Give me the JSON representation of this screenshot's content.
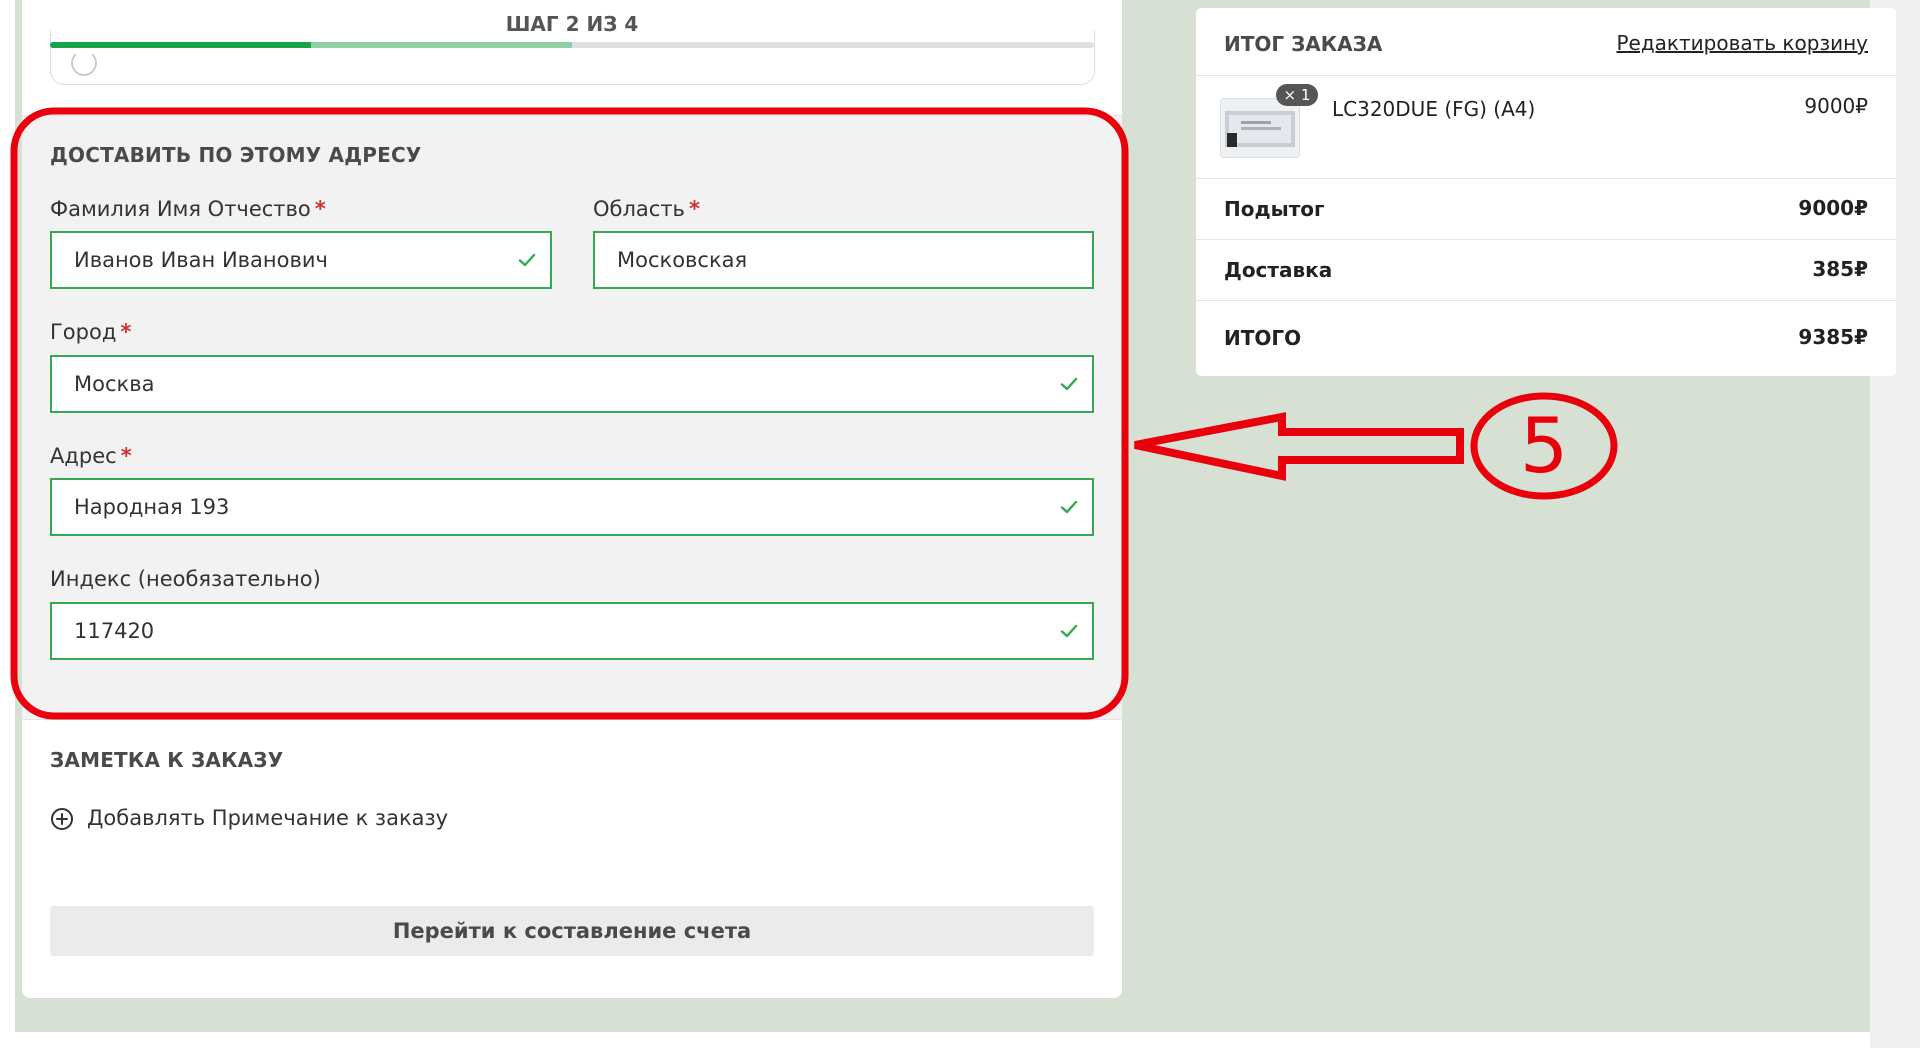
{
  "checkout": {
    "step_label": "ШАГ 2 ИЗ 4",
    "progress": {
      "current_step": 2,
      "total_steps": 4
    },
    "address_section": {
      "heading": "ДОСТАВИТЬ ПО ЭТОМУ АДРЕСУ",
      "required_mark": "*",
      "fields": {
        "full_name": {
          "label": "Фамилия Имя Отчество",
          "value": "Иванов Иван Иванович"
        },
        "region": {
          "label": "Область",
          "value": "Московская"
        },
        "city": {
          "label": "Город",
          "value": "Москва"
        },
        "address": {
          "label": "Адрес",
          "value": "Народная 193"
        },
        "postcode": {
          "label": "Индекс (необязательно)",
          "value": "117420"
        }
      }
    },
    "note_section": {
      "heading": "ЗАМЕТКА К ЗАКАЗУ",
      "add_note_label": "Добавлять Примечание к заказу"
    },
    "submit_label": "Перейти к составление счета"
  },
  "order_summary": {
    "title": "ИТОГ ЗАКАЗА",
    "edit_cart_label": "Редактировать корзину",
    "item": {
      "name": "LC320DUE (FG) (A4)",
      "qty_badge": "× 1",
      "price": "9000₽"
    },
    "subtotal": {
      "label": "Подытог",
      "value": "9000₽"
    },
    "shipping": {
      "label": "Доставка",
      "value": "385₽"
    },
    "total": {
      "label": "ИТОГО",
      "value": "9385₽"
    }
  },
  "annotation": {
    "number": "5"
  },
  "colors": {
    "accent_green": "#16a34a",
    "field_border": "#34a853",
    "annotation_red": "#e8000d",
    "page_bg": "#d7e1d3"
  }
}
